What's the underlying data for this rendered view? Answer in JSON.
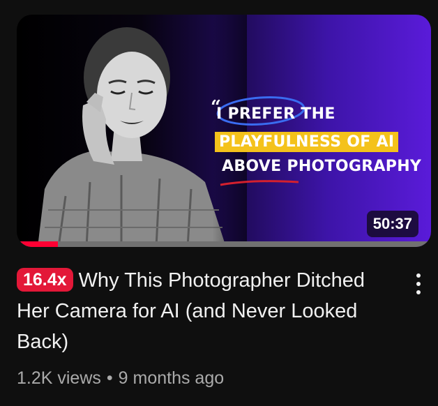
{
  "video": {
    "thumbnail": {
      "quote_open": "“",
      "line1": "I PREFER THE",
      "line2": "PLAYFULNESS OF AI",
      "line3": "ABOVE PHOTOGRAPHY",
      "highlight_color": "#f4c21b",
      "accent_color": "#5a1bd9"
    },
    "duration": "50:37",
    "watch_progress": 0.1,
    "badge": "16.4x",
    "title": "Why This Photographer Ditched Her Camera for AI (and Never Looked Back)",
    "views": "1.2K views",
    "separator": "•",
    "age": "9 months ago"
  },
  "icons": {
    "more": "more-vert-icon"
  }
}
